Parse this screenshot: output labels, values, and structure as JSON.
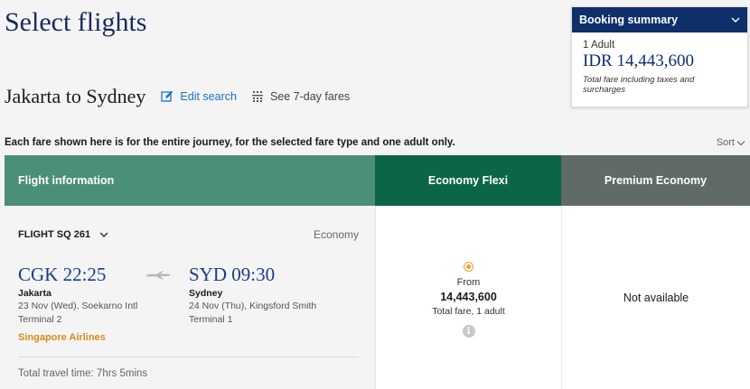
{
  "page": {
    "title": "Select flights"
  },
  "route": {
    "title": "Jakarta to Sydney",
    "edit_label": "Edit search",
    "fares_label": "See 7-day fares"
  },
  "booking_summary": {
    "header": "Booking summary",
    "passengers": "1 Adult",
    "price": "IDR 14,443,600",
    "note": "Total fare including taxes and surcharges"
  },
  "notice": "Each fare shown here is for the entire journey, for the selected fare type and one adult only.",
  "sort_label": "Sort",
  "columns": {
    "info": "Flight information",
    "economy": "Economy Flexi",
    "premium": "Premium Economy"
  },
  "flight": {
    "number": "FLIGHT SQ 261",
    "cabin": "Economy",
    "departure": {
      "code_time": "CGK 22:25",
      "city": "Jakarta",
      "date_airport": "23 Nov (Wed), Soekarno Intl",
      "terminal": "Terminal 2"
    },
    "arrival": {
      "code_time": "SYD 09:30",
      "city": "Sydney",
      "date_airport": "24 Nov (Thu), Kingsford Smith",
      "terminal": "Terminal 1"
    },
    "airline": "Singapore Airlines",
    "travel_time": "Total travel time: 7hrs 5mins"
  },
  "economy_fare": {
    "from_label": "From",
    "price": "14,443,600",
    "note": "Total fare, 1 adult",
    "info_glyph": "i"
  },
  "premium_fare": {
    "status": "Not available"
  },
  "colors": {
    "brand_navy": "#0f2f6b",
    "info_header": "#4b8f77",
    "economy_header": "#0d6548",
    "premium_header": "#606a66",
    "airline_accent": "#d98a1a",
    "link_blue": "#1a73c7"
  },
  "icons": [
    "edit-icon",
    "calendar-grid-icon",
    "chevron-down-icon",
    "plane-icon",
    "radio-selected-icon",
    "info-icon"
  ]
}
